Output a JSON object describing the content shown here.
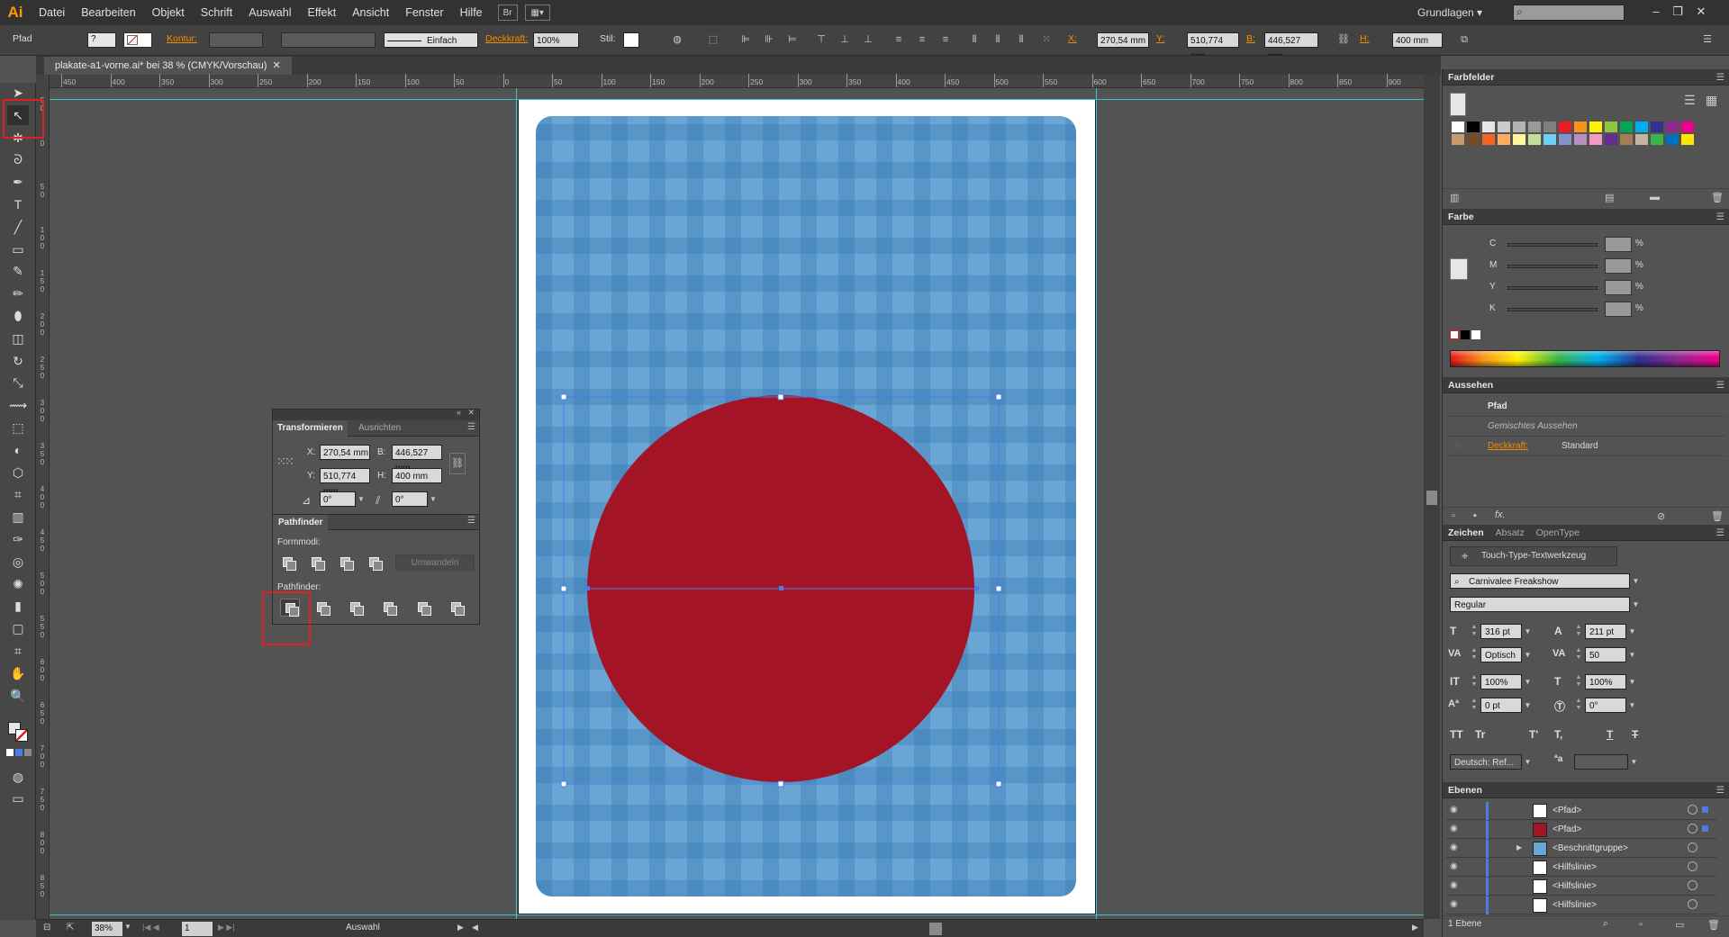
{
  "app": {
    "logo": "Ai"
  },
  "menu": [
    "Datei",
    "Bearbeiten",
    "Objekt",
    "Schrift",
    "Auswahl",
    "Effekt",
    "Ansicht",
    "Fenster",
    "Hilfe"
  ],
  "menubar_buttons": {
    "bridge": "Br",
    "arrange_icon": "arrange-documents-icon"
  },
  "workspace": "Grundlagen",
  "window_buttons": {
    "minimize": "–",
    "restore": "❐",
    "close": "✕"
  },
  "control": {
    "selection_type": "Pfad",
    "kontur_label": "Kontur:",
    "stroke_profile": "Einfach",
    "opacity_label": "Deckkraft:",
    "opacity_value": "100%",
    "style_label": "Stil:",
    "x_label": "X:",
    "x_value": "270,54 mm",
    "y_label": "Y:",
    "y_value": "510,774 mm",
    "b_label": "B:",
    "b_value": "446,527 mm",
    "h_label": "H:",
    "h_value": "400 mm"
  },
  "document": {
    "tab_title": "plakate-a1-vorne.ai* bei 38 % (CMYK/Vorschau)"
  },
  "ruler_h": [
    "450",
    "400",
    "350",
    "300",
    "250",
    "200",
    "150",
    "100",
    "50",
    "0",
    "50",
    "100",
    "150",
    "200",
    "250",
    "300",
    "350",
    "400",
    "450",
    "500",
    "550",
    "600",
    "650",
    "700",
    "750",
    "800",
    "850",
    "900"
  ],
  "ruler_v": [
    "50",
    "0",
    "50",
    "100",
    "150",
    "200",
    "250",
    "300",
    "350",
    "400",
    "450",
    "500",
    "550",
    "600",
    "650",
    "700",
    "750",
    "800",
    "850"
  ],
  "tools": [
    "selection-tool",
    "direct-selection-tool",
    "magic-wand-tool",
    "lasso-tool",
    "pen-tool",
    "type-tool",
    "line-tool",
    "rectangle-tool",
    "paintbrush-tool",
    "pencil-tool",
    "blob-brush-tool",
    "eraser-tool",
    "rotate-tool",
    "scale-tool",
    "width-tool",
    "free-transform-tool",
    "shape-builder-tool",
    "perspective-grid-tool",
    "mesh-tool",
    "gradient-tool",
    "eyedropper-tool",
    "blend-tool",
    "symbol-sprayer-tool",
    "column-graph-tool",
    "artboard-tool",
    "slice-tool",
    "hand-tool",
    "zoom-tool"
  ],
  "transform_panel": {
    "tab_active": "Transformieren",
    "tab_inactive": "Ausrichten",
    "x_label": "X:",
    "x_value": "270,54 mm",
    "y_label": "Y:",
    "y_value": "510,774 mm",
    "b_label": "B:",
    "b_value": "446,527 mm",
    "h_label": "H:",
    "h_value": "400 mm",
    "angle_value": "0°",
    "shear_value": "0°"
  },
  "pathfinder_panel": {
    "title": "Pathfinder",
    "formmodi_label": "Formmodi:",
    "umwandeln_label": "Umwandeln",
    "pathfinder_label": "Pathfinder:"
  },
  "farbfelder": {
    "title": "Farbfelder"
  },
  "farbfelder_swatches": [
    "#ffffff",
    "#000000",
    "#e6e6e6",
    "#cccccc",
    "#b3b3b3",
    "#999999",
    "#808080",
    "#ed1c24",
    "#f7941d",
    "#fff200",
    "#8dc63f",
    "#00a651",
    "#00aeef",
    "#2e3192",
    "#92278f",
    "#ec008c",
    "#c69c6d",
    "#754c24",
    "#f26522",
    "#fbaf5d",
    "#fff799",
    "#c4df9b",
    "#6dcff6",
    "#8393ca",
    "#bd8cbf",
    "#f49ac1",
    "#662d91",
    "#a67c52",
    "#c2b59b",
    "#39b54a",
    "#0072bc",
    "#ffe600"
  ],
  "farbe": {
    "title": "Farbe",
    "channels": [
      {
        "label": "C",
        "unit": "%"
      },
      {
        "label": "M",
        "unit": "%"
      },
      {
        "label": "Y",
        "unit": "%"
      },
      {
        "label": "K",
        "unit": "%"
      }
    ]
  },
  "aussehen": {
    "title": "Aussehen",
    "object": "Pfad",
    "mixed": "Gemischtes Aussehen",
    "opacity_label": "Deckkraft:",
    "opacity_value": "Standard",
    "fx": "fx."
  },
  "zeichen": {
    "tab_active": "Zeichen",
    "tab2": "Absatz",
    "tab3": "OpenType",
    "touch_type": "Touch-Type-Textwerkzeug",
    "font_family": "Carnivalee Freakshow",
    "font_style": "Regular",
    "font_size": "316 pt",
    "leading": "211 pt",
    "kerning": "Optisch",
    "tracking": "50",
    "vertical_scale": "100%",
    "horizontal_scale": "100%",
    "baseline_shift": "0 pt",
    "rotation": "0°",
    "language": "Deutsch: Ref...",
    "caps": [
      "TT",
      "Tr",
      "T'",
      "T,",
      "T",
      "T"
    ],
    "aa": "a"
  },
  "ebenen": {
    "title": "Ebenen",
    "layers": [
      {
        "name": "<Pfad>",
        "thumb": "#ffffff"
      },
      {
        "name": "<Pfad>",
        "thumb": "#a31426"
      },
      {
        "name": "<Beschnittgruppe>",
        "thumb": "#6aa5d3"
      },
      {
        "name": "<Hilfslinie>",
        "thumb": "#ffffff"
      },
      {
        "name": "<Hilfslinie>",
        "thumb": "#ffffff"
      },
      {
        "name": "<Hilfslinie>",
        "thumb": "#ffffff"
      }
    ],
    "footer": "1 Ebene"
  },
  "status": {
    "zoom": "38%",
    "page": "1",
    "tool": "Auswahl"
  },
  "colors": {
    "accent_orange": "#f08c00",
    "selection_blue": "#4b7be5",
    "guide_cyan": "#41c2c6",
    "circle_red": "#a31426",
    "plaid_blue": "#6aa5d3",
    "highlight_red": "#e02020"
  }
}
